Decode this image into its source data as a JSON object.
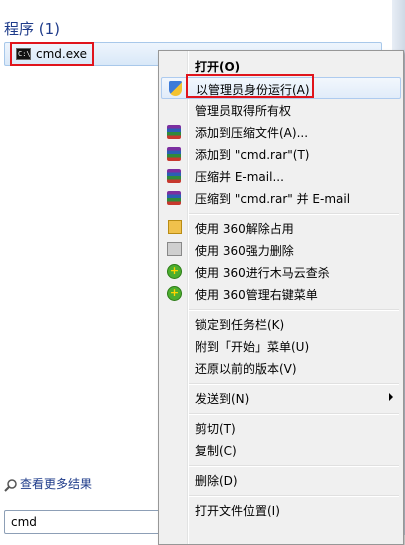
{
  "start_menu": {
    "section_title": "程序 (1)",
    "result": {
      "label": "cmd.exe",
      "icon": "cmd-icon",
      "icon_text": "C:\\"
    },
    "more_results": "查看更多结果",
    "search_value": "cmd"
  },
  "context_menu": {
    "items": [
      {
        "label": "打开(O)",
        "bold": true,
        "icon": ""
      },
      {
        "label": "以管理员身份运行(A)",
        "icon": "uac-shield-icon",
        "highlighted": true
      },
      {
        "label": "管理员取得所有权",
        "icon": ""
      },
      {
        "label": "添加到压缩文件(A)...",
        "icon": "winrar-icon"
      },
      {
        "label": "添加到 \"cmd.rar\"(T)",
        "icon": "winrar-icon"
      },
      {
        "label": "压缩并 E-mail...",
        "icon": "winrar-icon"
      },
      {
        "label": "压缩到 \"cmd.rar\" 并 E-mail",
        "icon": "winrar-icon"
      },
      {
        "label": "使用 360解除占用",
        "icon": "360-unlock-icon"
      },
      {
        "label": "使用 360强力删除",
        "icon": "360-shred-icon"
      },
      {
        "label": "使用 360进行木马云查杀",
        "icon": "360-scan-icon"
      },
      {
        "label": "使用 360管理右键菜单",
        "icon": "360-manage-icon"
      },
      {
        "label": "锁定到任务栏(K)",
        "icon": ""
      },
      {
        "label": "附到「开始」菜单(U)",
        "icon": ""
      },
      {
        "label": "还原以前的版本(V)",
        "icon": ""
      },
      {
        "label": "发送到(N)",
        "icon": "",
        "submenu": true
      },
      {
        "label": "剪切(T)",
        "icon": ""
      },
      {
        "label": "复制(C)",
        "icon": ""
      },
      {
        "label": "删除(D)",
        "icon": ""
      },
      {
        "label": "打开文件位置(I)",
        "icon": ""
      }
    ]
  },
  "colors": {
    "highlight_border": "#e0141c",
    "section_title": "#1e3b8a",
    "menu_bg": "#f0f0f0"
  }
}
